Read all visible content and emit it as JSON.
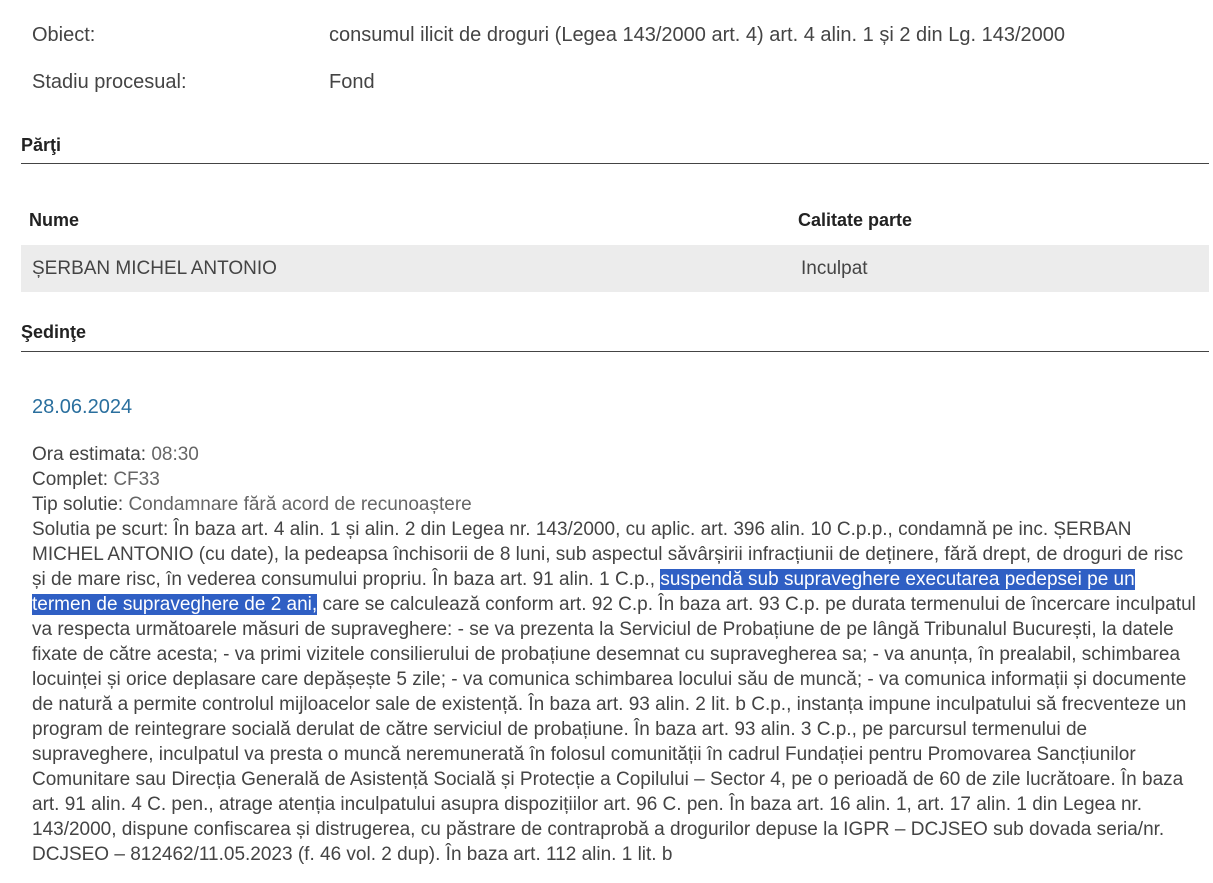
{
  "case_info": {
    "obiect_label": "Obiect:",
    "obiect_value": "consumul ilicit de droguri (Legea 143/2000 art. 4) art. 4 alin. 1 și 2 din Lg. 143/2000",
    "stadiu_label": "Stadiu procesual:",
    "stadiu_value": "Fond"
  },
  "parti": {
    "title": "Părţi",
    "col_nume": "Nume",
    "col_calitate": "Calitate parte",
    "rows": [
      {
        "nume": "ȘERBAN MICHEL ANTONIO",
        "calitate": "Inculpat"
      }
    ]
  },
  "sedinte": {
    "title": "Şedinţe",
    "date": "28.06.2024",
    "ora_label": "Ora estimata:",
    "ora_value": "08:30",
    "complet_label": "Complet:",
    "complet_value": "CF33",
    "tip_label": "Tip solutie:",
    "tip_value": "Condamnare fără acord de recunoaștere",
    "solutie_label": "Solutia pe scurt:",
    "solutie_before": "În baza art. 4 alin. 1 și alin. 2 din Legea nr. 143/2000, cu aplic. art. 396 alin. 10 C.p.p., condamnă pe inc. ȘERBAN MICHEL ANTONIO (cu date), la pedeapsa închisorii de 8 luni, sub aspectul săvârșirii infracțiunii de deținere, fără drept, de droguri de risc și de mare risc, în vederea consumului propriu. În baza art. 91 alin. 1 C.p.,",
    "solutie_highlight": "suspendă sub supraveghere executarea pedepsei pe un termen de supraveghere de 2 ani,",
    "solutie_after": "care se calculează conform art. 92 C.p. În baza art. 93 C.p. pe durata termenului de încercare inculpatul va respecta următoarele măsuri de supraveghere: - se va prezenta la Serviciul de Probațiune de pe lângă Tribunalul București, la datele fixate de către acesta; - va primi vizitele consilierului de probațiune desemnat cu supravegherea sa; - va anunța, în prealabil, schimbarea locuinței și orice deplasare care depășește 5 zile; - va comunica schimbarea locului său de muncă; - va comunica informații și documente de natură a permite controlul mijloacelor sale de existență. În baza art. 93 alin. 2 lit. b C.p., instanța impune inculpatului să frecventeze un program de reintegrare socială derulat de către serviciul de probațiune. În baza art. 93 alin. 3 C.p., pe parcursul termenului de supraveghere, inculpatul va presta o muncă neremunerată în folosul comunității în cadrul Fundației pentru Promovarea Sancțiunilor Comunitare sau Direcția Generală de Asistență Socială și Protecție a Copilului – Sector 4, pe o perioadă de 60 de zile lucrătoare. În baza art. 91 alin. 4 C. pen., atrage atenția inculpatului asupra dispozițiilor art. 96 C. pen. În baza art. 16 alin. 1, art. 17 alin. 1 din Legea nr. 143/2000, dispune confiscarea și distrugerea, cu păstrare de contraprobă a drogurilor depuse la IGPR – DCJSEO sub dovada seria/nr. DCJSEO – 812462/11.05.2023 (f. 46 vol. 2 dup). În baza art. 112 alin. 1 lit. b"
  },
  "colors": {
    "date_link": "#2a6f9e",
    "highlight_bg": "#2f5fc4",
    "row_bg": "#ececec"
  }
}
